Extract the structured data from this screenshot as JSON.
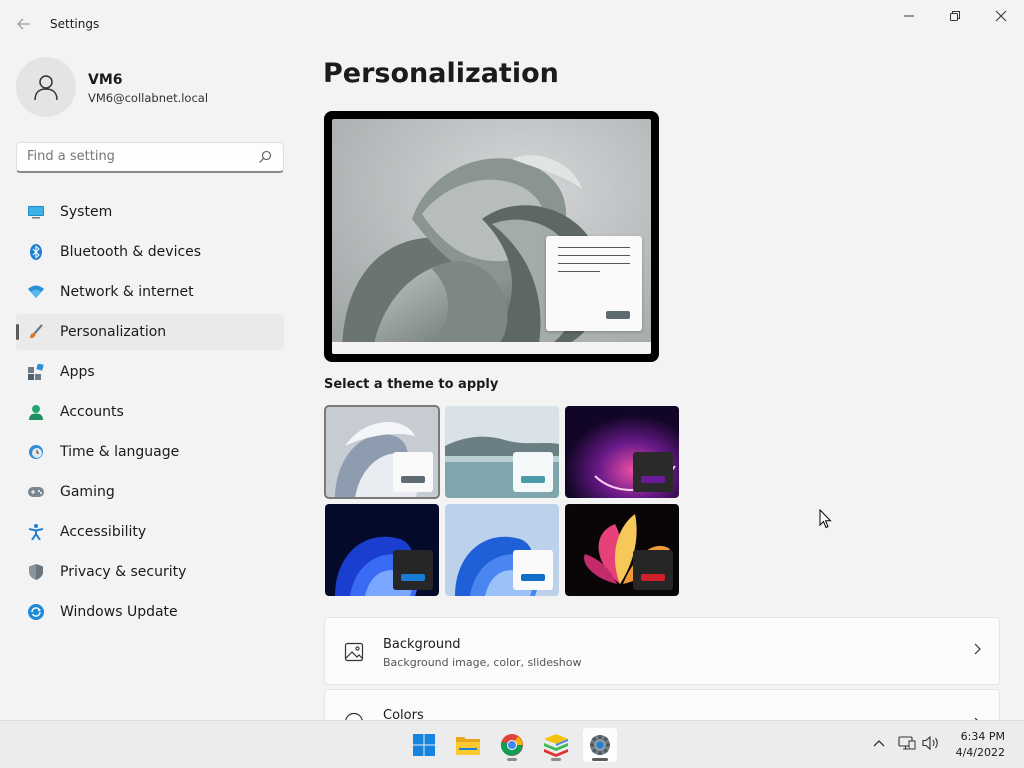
{
  "window": {
    "title": "Settings",
    "back_icon": "back-arrow-icon",
    "minimize_icon": "minimize-icon",
    "maximize_icon": "restore-icon",
    "close_icon": "close-icon"
  },
  "user": {
    "name": "VM6",
    "email": "VM6@collabnet.local",
    "avatar_icon": "person-icon"
  },
  "search": {
    "placeholder": "Find a setting",
    "value": "",
    "icon": "search-icon"
  },
  "sidebar": {
    "items": [
      {
        "label": "System",
        "icon": "system-icon",
        "active": false
      },
      {
        "label": "Bluetooth & devices",
        "icon": "bluetooth-icon",
        "active": false
      },
      {
        "label": "Network & internet",
        "icon": "wifi-icon",
        "active": false
      },
      {
        "label": "Personalization",
        "icon": "brush-icon",
        "active": true
      },
      {
        "label": "Apps",
        "icon": "apps-icon",
        "active": false
      },
      {
        "label": "Accounts",
        "icon": "accounts-icon",
        "active": false
      },
      {
        "label": "Time & language",
        "icon": "clock-globe-icon",
        "active": false
      },
      {
        "label": "Gaming",
        "icon": "gamepad-icon",
        "active": false
      },
      {
        "label": "Accessibility",
        "icon": "accessibility-icon",
        "active": false
      },
      {
        "label": "Privacy & security",
        "icon": "shield-icon",
        "active": false
      },
      {
        "label": "Windows Update",
        "icon": "windows-update-icon",
        "active": false
      }
    ]
  },
  "main": {
    "title": "Personalization",
    "theme_section_label": "Select a theme to apply",
    "themes": [
      {
        "name": "windows-light-bloom",
        "selected": true,
        "accent": "#5f6b72"
      },
      {
        "name": "lake",
        "selected": false,
        "accent": "#4a9aa8"
      },
      {
        "name": "purple-glow",
        "selected": false,
        "accent": "#6a1a9a"
      },
      {
        "name": "windows-dark-blue",
        "selected": false,
        "accent": "#1a7ad8"
      },
      {
        "name": "windows-light-blue",
        "selected": false,
        "accent": "#0f6fc8"
      },
      {
        "name": "flower-dark",
        "selected": false,
        "accent": "#d0202a"
      }
    ],
    "cards": [
      {
        "title": "Background",
        "subtitle": "Background image, color, slideshow",
        "icon": "image-icon"
      },
      {
        "title": "Colors",
        "subtitle": "",
        "icon": "palette-icon"
      }
    ]
  },
  "taskbar": {
    "apps": [
      {
        "name": "start-button",
        "icon": "windows-logo-icon"
      },
      {
        "name": "file-explorer",
        "icon": "folder-icon"
      },
      {
        "name": "chrome",
        "icon": "chrome-icon"
      },
      {
        "name": "bluestacks",
        "icon": "bluestacks-icon"
      },
      {
        "name": "settings",
        "icon": "settings-gear-icon"
      }
    ],
    "tray": [
      "chevron-up-icon",
      "network-icon",
      "volume-icon"
    ],
    "time": "6:34 PM",
    "date": "4/4/2022"
  },
  "colors": {
    "accent": "#0067c0",
    "background": "#f3f3f3"
  }
}
